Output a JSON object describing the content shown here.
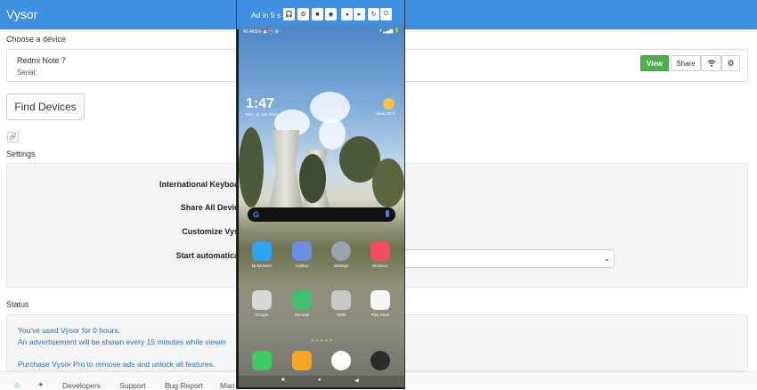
{
  "header": {
    "brand": "Vysor"
  },
  "choose_device_label": "Choose a device",
  "device": {
    "name": "Redmi Note 7",
    "serial_label": "Serial:",
    "view_label": "View",
    "share_label": "Share"
  },
  "find_devices_label": "Find Devices",
  "settings": {
    "label": "Settings",
    "rows": [
      {
        "label": "International Keyboa"
      },
      {
        "label": "Share All Devic"
      },
      {
        "label": "Customize Vys"
      },
      {
        "label": "Start automatica"
      }
    ]
  },
  "status": {
    "label": "Status",
    "line1": "You've used Vysor for 0 hours.",
    "line2": "An advertisement will be shown every 15 minutes while viewin",
    "line3": "Purchase Vysor Pro to remove ads and unlock all features."
  },
  "footer": {
    "items": [
      "Developers",
      "Support",
      "Bug Report",
      "Man"
    ]
  },
  "phone": {
    "ad_text": "Ad in 5 s",
    "status_left": "40.4KB/s ⏰ ⓢ ⚙ ·",
    "status_right": "▾ ▂▄▆ 🔋",
    "clock": "1:47",
    "date": "Mon, 11 Jan 2021",
    "temp": "Clear 20°C",
    "apps": [
      {
        "label": "Mi Browser",
        "color": "#2ea3f2"
      },
      {
        "label": "Gallery",
        "color": "#6f8ddf"
      },
      {
        "label": "Settings",
        "color": "#9aa3ad"
      },
      {
        "label": "Mi Music",
        "color": "#ef4d64"
      },
      {
        "label": "Google",
        "color": "#d7d7d7"
      },
      {
        "label": "Security",
        "color": "#3fbf6f"
      },
      {
        "label": "Tools",
        "color": "#c8c8c8"
      },
      {
        "label": "Play Store",
        "color": "#f5f5f5"
      },
      {
        "label": "",
        "color": "#3ecb5f"
      },
      {
        "label": "",
        "color": "#f5a623"
      },
      {
        "label": "",
        "color": "#ffffff"
      },
      {
        "label": "",
        "color": "#2b2b2b"
      }
    ]
  }
}
